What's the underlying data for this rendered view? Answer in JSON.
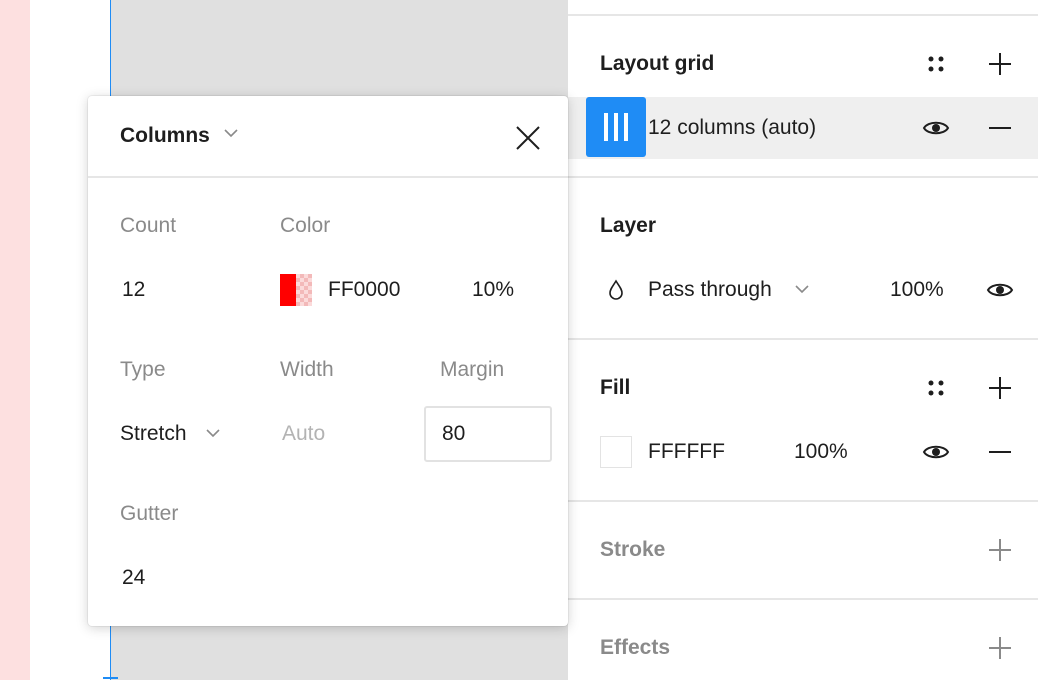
{
  "popover": {
    "title": "Columns",
    "labels": {
      "count": "Count",
      "color": "Color",
      "type": "Type",
      "width": "Width",
      "margin": "Margin",
      "gutter": "Gutter"
    },
    "values": {
      "count": "12",
      "color_hex": "FF0000",
      "color_opacity": "10%",
      "type": "Stretch",
      "width_placeholder": "Auto",
      "margin": "80",
      "gutter": "24"
    }
  },
  "panel": {
    "layout_grid": {
      "title": "Layout grid",
      "item_label": "12 columns (auto)"
    },
    "layer": {
      "title": "Layer",
      "blend_mode": "Pass through",
      "opacity": "100%"
    },
    "fill": {
      "title": "Fill",
      "hex": "FFFFFF",
      "opacity": "100%"
    },
    "stroke": {
      "title": "Stroke"
    },
    "effects": {
      "title": "Effects"
    }
  },
  "colors": {
    "accent": "#1f8cf5",
    "grid_color": "#ff0000",
    "canvas_frame": "#e0e0e0",
    "canvas_strip": "#fde0e0"
  },
  "icons": [
    "grid-columns-icon",
    "close-icon",
    "chevron-down-icon",
    "eye-icon",
    "plus-icon",
    "minus-icon",
    "styles-icon",
    "blend-drop-icon"
  ]
}
